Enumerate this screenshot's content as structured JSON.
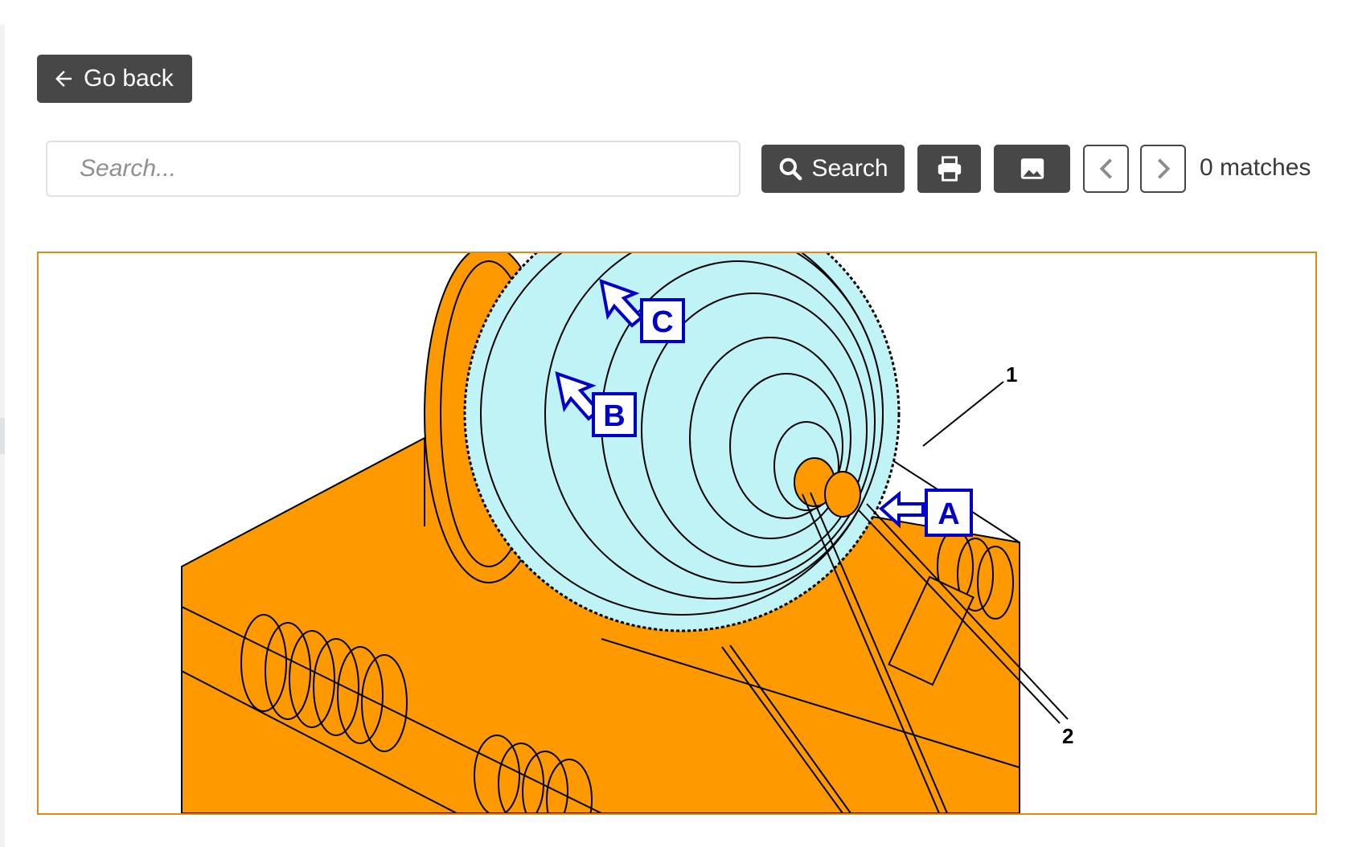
{
  "toolbar": {
    "back_label": "Go back",
    "search_placeholder": "Search...",
    "search_label": "Search",
    "matches_text": "0 matches"
  },
  "icons": {
    "back": "arrow-left-icon",
    "search": "magnifier-icon",
    "print": "printer-icon",
    "image": "image-icon",
    "prev": "chevron-left-icon",
    "next": "chevron-right-icon"
  },
  "figure": {
    "callouts": [
      "1",
      "2"
    ],
    "view_labels": [
      "A",
      "B",
      "C"
    ],
    "colors": {
      "frame": "#ff9900",
      "engine": "#bff3f5",
      "callout": "#0000cc",
      "border": "#e08a1a"
    }
  }
}
